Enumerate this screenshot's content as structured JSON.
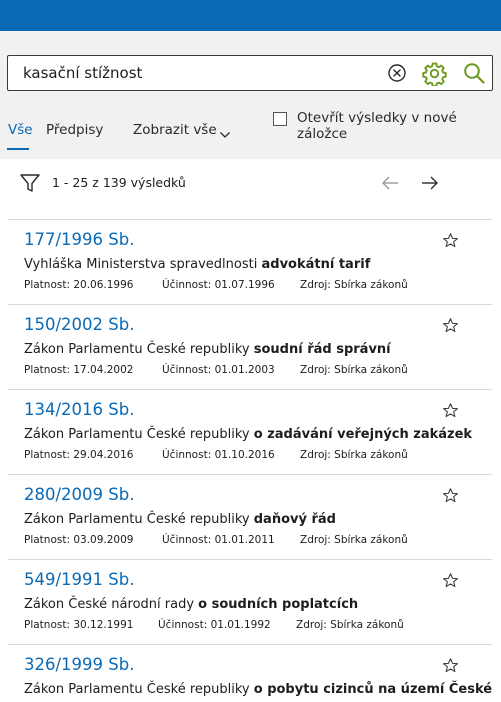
{
  "search": {
    "value": "kasační stížnost"
  },
  "tabs": {
    "all": "Vše",
    "predpisy": "Předpisy",
    "show_all": "Zobrazit vše"
  },
  "new_tab_option": {
    "label": "Otevřít výsledky v nové záložce",
    "checked": false
  },
  "results_count": "1 - 25 z 139 výsledků",
  "colors": {
    "brand": "#0b6ab6",
    "gear": "#6b9a1f"
  },
  "results": [
    {
      "title": "177/1996 Sb.",
      "desc_plain": "Vyhláška Ministerstva spravedlnosti ",
      "desc_bold": "advokátní tarif",
      "platnost": "Platnost: 20.06.1996",
      "ucinnost": "Účinnost: 01.07.1996",
      "zdroj": "Zdroj: Sbírka zákonů"
    },
    {
      "title": "150/2002 Sb.",
      "desc_plain": "Zákon Parlamentu České republiky ",
      "desc_bold": "soudní řád správní",
      "platnost": "Platnost: 17.04.2002",
      "ucinnost": "Účinnost: 01.01.2003",
      "zdroj": "Zdroj: Sbírka zákonů"
    },
    {
      "title": "134/2016 Sb.",
      "desc_plain": "Zákon Parlamentu České republiky ",
      "desc_bold": "o zadávání veřejných zakázek",
      "platnost": "Platnost: 29.04.2016",
      "ucinnost": "Účinnost: 01.10.2016",
      "zdroj": "Zdroj: Sbírka zákonů"
    },
    {
      "title": "280/2009 Sb.",
      "desc_plain": "Zákon Parlamentu České republiky ",
      "desc_bold": "daňový řád",
      "platnost": "Platnost: 03.09.2009",
      "ucinnost": "Účinnost: 01.01.2011",
      "zdroj": "Zdroj: Sbírka zákonů"
    },
    {
      "title": "549/1991 Sb.",
      "desc_plain": "Zákon České národní rady ",
      "desc_bold": "o soudních poplatcích",
      "platnost": "Platnost: 30.12.1991",
      "ucinnost": "Účinnost: 01.01.1992",
      "zdroj": "Zdroj: Sbírka zákonů"
    },
    {
      "title": "326/1999 Sb.",
      "desc_plain": "Zákon Parlamentu České republiky ",
      "desc_bold": "o pobytu cizinců na území České",
      "platnost": "",
      "ucinnost": "",
      "zdroj": ""
    }
  ]
}
